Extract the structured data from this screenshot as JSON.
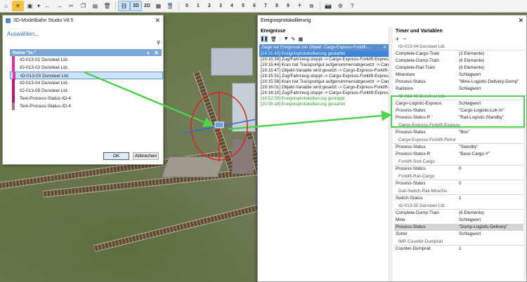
{
  "toolbar": {
    "items": [
      "home-icon",
      "tools-icon",
      "save-icon",
      "chevron-down-icon",
      "undo-icon",
      "redo-icon",
      "cut-icon",
      "copy-icon",
      "paste-icon",
      "delete-icon",
      "link-icon"
    ],
    "view_3d": "3D",
    "view_2d": "2D",
    "numbers": [
      "0",
      "1",
      "2",
      "3",
      "4",
      "5",
      "6",
      "7",
      "8",
      "9"
    ]
  },
  "dialog": {
    "title": "3D-Modellbahn Studio V8.5",
    "heading": "Auswählen...",
    "list_header": "Name \"io-\"",
    "items": [
      {
        "label": "IO-013-01 Dunsteel Ltd.",
        "color": "#e62ea8"
      },
      {
        "label": "IO-013-02 Dunsteel Ltd.",
        "color": "#e62ea8"
      },
      {
        "label": "IO-013-03 Dunsteel Ltd.",
        "color": "#e62ea8"
      },
      {
        "label": "IO-013-04 Dunsteel Ltd.",
        "color": "#c2186f"
      },
      {
        "label": "IO-013-05 Dunsteel Ltd.",
        "color": "#c2186f"
      },
      {
        "label": "Text-Process-Status-IO-4",
        "color": "#a0206e"
      },
      {
        "label": "Text-Process-Status-IO-4",
        "color": "#b07080"
      }
    ],
    "selected_index": 2,
    "ok_label": "OK",
    "cancel_label": "Abbrechen"
  },
  "events": {
    "title": "Ereignisprotokollierung",
    "left_heading": "Ereignisse",
    "filter_text": "Zeige nur Ereignisse von Objekt: Cargo-Express-Forklift-...",
    "lines": [
      {
        "text": "[14:21:43] Ereignisprotokollierung gestartet",
        "style": "sel"
      },
      {
        "text": "[19:15:39] Zug/Fahrzeug stoppt -> Cargo-Express-Forklift-Express",
        "style": ""
      },
      {
        "text": "[19:15:44] Kran hat Transportgut aufgenommen/abgesetzt -> Cargo-Express-",
        "style": ""
      },
      {
        "text": "[19:15:47]   Objekt-Variable wird gesetzt -> Cargo-Express-Forklift-E",
        "style": ""
      },
      {
        "text": "[19:15:51] Zug/Fahrzeug stoppt -> Cargo-Express-Forklift-Express",
        "style": ""
      },
      {
        "text": "[19:15:56] Kran hat Transportgut aufgenommen/abgesetzt -> Cargo-Express-",
        "style": ""
      },
      {
        "text": "[19:16:01]   Objekt-Variable wird gesetzt -> Cargo-Express-Forklift-E",
        "style": ""
      },
      {
        "text": "[19:16:10] Zug/Fahrzeug stoppt -> Cargo-Express-Forklift-Express",
        "style": ""
      },
      {
        "text": "[19:52:59] Ereignisprotokollierung gestoppt",
        "style": "green"
      },
      {
        "text": "[20:05:18] Ereignisprotokollierung gestartet",
        "style": "green"
      }
    ],
    "right_heading": "Timer und Variablen",
    "vars": [
      {
        "type": "group",
        "label": "IO-013-04 Dunsteel Ltd."
      },
      {
        "type": "row",
        "k": "Complete-Cargo-Train",
        "v": "(2 Elemente)"
      },
      {
        "type": "row",
        "k": "Complete-Dump-Train",
        "v": "(6 Elemente)"
      },
      {
        "type": "row",
        "k": "Complete-Rail-Train",
        "v": "(6 Elemente)"
      },
      {
        "type": "row",
        "k": "Minestore",
        "v": "Schlagwort"
      },
      {
        "type": "row",
        "k": "Process-Status",
        "v": "\"Mine-Logistic-Delivery-Dump\""
      },
      {
        "type": "row",
        "k": "Railstore",
        "v": "Schlagwort"
      },
      {
        "type": "group",
        "label": "IO-013-03 Dunsteel Ltd."
      },
      {
        "type": "row",
        "k": "Cargo-Logistic-Express",
        "v": "Schlagwort"
      },
      {
        "type": "row",
        "k": "Process-Status",
        "v": "\"Cargo-Logistic-Lok-In\""
      },
      {
        "type": "row",
        "k": "Process-Status-R",
        "v": "\"Rail-Logistic-Standby\""
      },
      {
        "type": "group",
        "label": "Cargo-Express-Forklift-Express"
      },
      {
        "type": "row",
        "k": "Process-Status",
        "v": "\"Box\""
      },
      {
        "type": "group",
        "label": "Cargo-Express-Forklift-Petrol"
      },
      {
        "type": "row",
        "k": "Process-Status",
        "v": "\"Standby\""
      },
      {
        "type": "row",
        "k": "Process-Status-R",
        "v": "\"Base-Cargo-Y\""
      },
      {
        "type": "group",
        "label": "Forklift-Sort-Cargo"
      },
      {
        "type": "row",
        "k": "Process-Status",
        "v": "0"
      },
      {
        "type": "group",
        "label": "Forklift-Rail-Cargo"
      },
      {
        "type": "row",
        "k": "Process-Status",
        "v": "0"
      },
      {
        "type": "group",
        "label": "Dull-Switch-Rail-MineSto"
      },
      {
        "type": "row",
        "k": "Switch-Status",
        "v": "1"
      },
      {
        "type": "group",
        "label": "IO-013-05 Dunsteel Ltd."
      },
      {
        "type": "row",
        "k": "Complete-Dump-Train",
        "v": "(6 Elemente)"
      },
      {
        "type": "row",
        "k": "Mine",
        "v": "Schlagwort"
      },
      {
        "type": "row",
        "k": "Process-Status",
        "v": "\"Dump-Logistic-Delivery\"",
        "hl": true
      },
      {
        "type": "row",
        "k": "Sorter",
        "v": "Schlagwort"
      },
      {
        "type": "group",
        "label": "IMP-Counter-Dumprail"
      },
      {
        "type": "row",
        "k": "Counter-Dumprail",
        "v": "1"
      }
    ]
  },
  "colors": {
    "accent": "#2b6cb0",
    "highlight": "#4fd14f",
    "selection": "#3b86d6"
  }
}
